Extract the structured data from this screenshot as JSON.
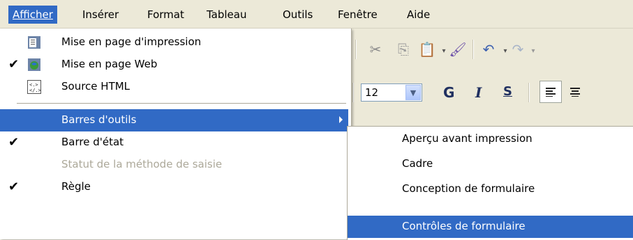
{
  "menubar": [
    {
      "label": "Afficher",
      "active": true
    },
    {
      "label": "Insérer"
    },
    {
      "label": "Format"
    },
    {
      "label": "Tableau"
    },
    {
      "label": "Outils"
    },
    {
      "label": "Fenêtre"
    },
    {
      "label": "Aide"
    }
  ],
  "toolbar": {
    "font_size": "12",
    "bold_label": "G",
    "italic_label": "I",
    "underline_label": "S"
  },
  "menu": {
    "items": [
      {
        "label": "Mise en page d'impression",
        "icon": "print-layout-icon"
      },
      {
        "label": "Mise en page Web",
        "icon": "web-layout-icon",
        "checked": true
      },
      {
        "label": "Source HTML",
        "icon": "html-source-icon"
      },
      {
        "label": "Barres d'outils",
        "submenu": true,
        "highlighted": true
      },
      {
        "label": "Barre d'état",
        "checked": true
      },
      {
        "label": "Statut de la méthode de saisie",
        "disabled": true
      },
      {
        "label": "Règle",
        "checked": true
      }
    ]
  },
  "submenu": {
    "items": [
      {
        "label": "Aperçu avant impression"
      },
      {
        "label": "Cadre"
      },
      {
        "label": "Conception de formulaire"
      },
      {
        "label": "Contrôles de formulaire",
        "highlighted": true
      }
    ]
  },
  "colors": {
    "highlight": "#316ac5",
    "menubar_bg": "#ece9d8",
    "disabled": "#aca899"
  }
}
